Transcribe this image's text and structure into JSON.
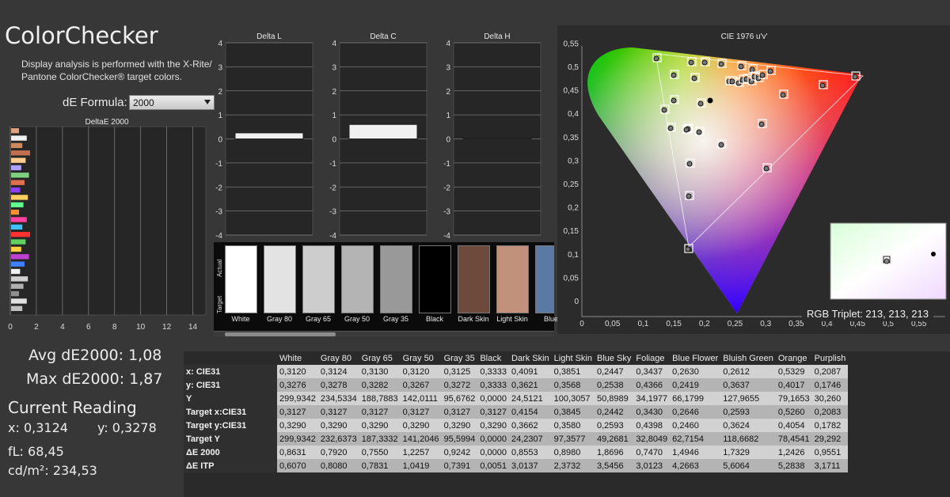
{
  "app": {
    "title": "ColorChecker",
    "description": "Display analysis is performed with the X-Rite/ Pantone ColorChecker® target colors.",
    "formula_label": "dE Formula:",
    "formula_value": "2000"
  },
  "summary": {
    "avg": "Avg dE2000: 1,08",
    "max": "Max dE2000: 1,87",
    "current_reading": "Current Reading",
    "x": "x: 0,3124",
    "y": "y: 0,3278",
    "fl": "fL: 68,45",
    "cdm2": "cd/m²: 234,53"
  },
  "deltae_chart": {
    "title": "DeltaE 2000",
    "x_ticks": [
      "0",
      "2",
      "4",
      "6",
      "8",
      "10",
      "12",
      "14"
    ]
  },
  "delta_charts": [
    {
      "title": "Delta L",
      "y_ticks": [
        "4",
        "3",
        "2",
        "1",
        "0",
        "-1",
        "-2",
        "-3",
        "-4"
      ]
    },
    {
      "title": "Delta C",
      "y_ticks": [
        "4",
        "3",
        "2",
        "1",
        "0",
        "-1",
        "-2",
        "-3",
        "-4"
      ]
    },
    {
      "title": "Delta H",
      "y_ticks": [
        "4",
        "3",
        "2",
        "1",
        "0",
        "-1",
        "-2",
        "-3",
        "-4"
      ]
    }
  ],
  "swatches": {
    "actual_label": "Actual",
    "target_label": "Target",
    "items": [
      {
        "label": "White",
        "color": "#ffffff"
      },
      {
        "label": "Gray 80",
        "color": "#e3e3e3"
      },
      {
        "label": "Gray 65",
        "color": "#cdcdcd"
      },
      {
        "label": "Gray 50",
        "color": "#b4b4b4"
      },
      {
        "label": "Gray 35",
        "color": "#999999"
      },
      {
        "label": "Black",
        "color": "#000000"
      },
      {
        "label": "Dark Skin",
        "color": "#6e4a3c"
      },
      {
        "label": "Light Skin",
        "color": "#c2917c"
      },
      {
        "label": "Blue",
        "color": "#5a7aa3"
      }
    ]
  },
  "cie": {
    "title": "CIE 1976 u'v'",
    "x_ticks": [
      "0",
      "0,05",
      "0,1",
      "0,15",
      "0,2",
      "0,25",
      "0,3",
      "0,35",
      "0,4",
      "0,45",
      "0,5",
      "0,55"
    ],
    "y_ticks": [
      "0,55",
      "0,5",
      "0,45",
      "0,4",
      "0,35",
      "0,3",
      "0,25",
      "0,2",
      "0,15",
      "0,1",
      "0,05",
      "0"
    ],
    "rgb_triplet": "RGB Triplet: 213, 213, 213"
  },
  "table": {
    "columns": [
      "White",
      "Gray 80",
      "Gray 65",
      "Gray 50",
      "Gray 35",
      "Black",
      "Dark Skin",
      "Light Skin",
      "Blue Sky",
      "Foliage",
      "Blue Flower",
      "Bluish Green",
      "Orange",
      "Purplish"
    ],
    "rows": [
      {
        "label": "x: CIE31",
        "values": [
          "0,3120",
          "0,3124",
          "0,3130",
          "0,3120",
          "0,3125",
          "0,3333",
          "0,4091",
          "0,3851",
          "0,2447",
          "0,3437",
          "0,2630",
          "0,2612",
          "0,5329",
          "0,2087"
        ]
      },
      {
        "label": "y: CIE31",
        "values": [
          "0,3276",
          "0,3278",
          "0,3282",
          "0,3267",
          "0,3272",
          "0,3333",
          "0,3621",
          "0,3568",
          "0,2538",
          "0,4366",
          "0,2419",
          "0,3637",
          "0,4017",
          "0,1746"
        ]
      },
      {
        "label": "Y",
        "values": [
          "299,9342",
          "234,5334",
          "188,7883",
          "142,0111",
          "95,6762",
          "0,0000",
          "24,5121",
          "100,3057",
          "50,8989",
          "34,1977",
          "66,1799",
          "127,9655",
          "79,1653",
          "30,260"
        ]
      },
      {
        "label": "Target x:CIE31",
        "values": [
          "0,3127",
          "0,3127",
          "0,3127",
          "0,3127",
          "0,3127",
          "0,3127",
          "0,4154",
          "0,3845",
          "0,2442",
          "0,3430",
          "0,2646",
          "0,2593",
          "0,5260",
          "0,2083"
        ]
      },
      {
        "label": "Target y:CIE31",
        "values": [
          "0,3290",
          "0,3290",
          "0,3290",
          "0,3290",
          "0,3290",
          "0,3290",
          "0,3662",
          "0,3580",
          "0,2593",
          "0,4398",
          "0,2460",
          "0,3624",
          "0,4054",
          "0,1782"
        ]
      },
      {
        "label": "Target Y",
        "values": [
          "299,9342",
          "232,6373",
          "187,3332",
          "141,2046",
          "95,5994",
          "0,0000",
          "24,2307",
          "97,3577",
          "49,2681",
          "32,8049",
          "62,7154",
          "118,6682",
          "78,4541",
          "29,292"
        ]
      },
      {
        "label": "ΔE 2000",
        "values": [
          "0,8631",
          "0,7920",
          "0,7550",
          "1,2257",
          "0,9242",
          "0,0000",
          "0,8553",
          "0,8980",
          "1,8696",
          "0,7470",
          "1,4946",
          "1,7329",
          "1,2426",
          "0,9551"
        ]
      },
      {
        "label": "ΔE ITP",
        "values": [
          "0,6070",
          "0,8080",
          "0,7831",
          "1,0419",
          "0,7391",
          "0,0051",
          "3,0137",
          "2,3732",
          "3,5456",
          "3,0123",
          "4,2663",
          "5,6064",
          "5,2838",
          "3,1711"
        ]
      }
    ]
  },
  "chart_data": {
    "type": "bar",
    "title": "Delta C",
    "categories": [
      "Gray 80"
    ],
    "values": [
      0.6
    ],
    "ylim": [
      -4,
      4
    ]
  }
}
